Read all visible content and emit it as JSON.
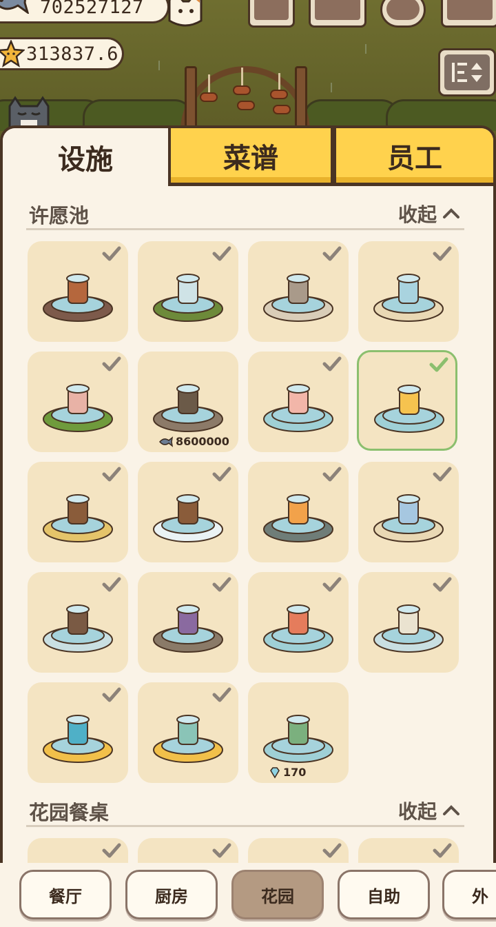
{
  "hud": {
    "fish_currency": "702527127",
    "star_currency": "313837.6"
  },
  "tabs": [
    {
      "label": "设施",
      "active": true
    },
    {
      "label": "菜谱",
      "active": false
    },
    {
      "label": "员工",
      "active": false
    }
  ],
  "sections": [
    {
      "title": "许愿池",
      "collapse_label": "收起",
      "items": [
        {
          "name": "clay-pot-fountain",
          "owned": true
        },
        {
          "name": "birdbath-fountain",
          "owned": true
        },
        {
          "name": "bamboo-stone-fountain",
          "owned": true
        },
        {
          "name": "cat-statue-fountain",
          "owned": true
        },
        {
          "name": "teacup-fountain",
          "owned": true
        },
        {
          "name": "old-well",
          "owned": false,
          "price": "8600000",
          "currency_icon": "fish-icon"
        },
        {
          "name": "cotton-candy-fountain",
          "owned": true
        },
        {
          "name": "pineapple-fountain",
          "owned": true,
          "selected": true
        },
        {
          "name": "barrel-fountain",
          "owned": true
        },
        {
          "name": "bell-wood-fountain",
          "owned": true
        },
        {
          "name": "whale-fountain",
          "owned": true
        },
        {
          "name": "globe-gazebo-fountain",
          "owned": true
        },
        {
          "name": "ship-wheel-fountain",
          "owned": true
        },
        {
          "name": "bat-wing-fountain",
          "owned": true
        },
        {
          "name": "salmon-sushi-fountain",
          "owned": true
        },
        {
          "name": "goddess-statue-fountain",
          "owned": true
        },
        {
          "name": "star-waterfall-fountain",
          "owned": true
        },
        {
          "name": "dragon-rock-fountain",
          "owned": true
        },
        {
          "name": "gazebo-pond-fountain",
          "owned": false,
          "price": "170",
          "currency_icon": "diamond-icon"
        }
      ]
    },
    {
      "title": "花园餐桌",
      "collapse_label": "收起",
      "items": [
        {
          "name": "table-1",
          "owned": true
        },
        {
          "name": "table-2",
          "owned": true
        },
        {
          "name": "table-3",
          "owned": true
        },
        {
          "name": "table-4",
          "owned": true
        }
      ]
    }
  ],
  "bottom_nav": [
    {
      "label": "餐厅",
      "active": false
    },
    {
      "label": "厨房",
      "active": false
    },
    {
      "label": "花园",
      "active": true
    },
    {
      "label": "自助",
      "active": false
    },
    {
      "label": "外",
      "active": false
    }
  ],
  "colors": {
    "panel_bg": "#faf3e7",
    "card_bg": "#f4e4c2",
    "tab_inactive": "#ffd24d",
    "selected_border": "#8bbf6e",
    "nav_active": "#b49a82",
    "outline": "#4a3424"
  }
}
